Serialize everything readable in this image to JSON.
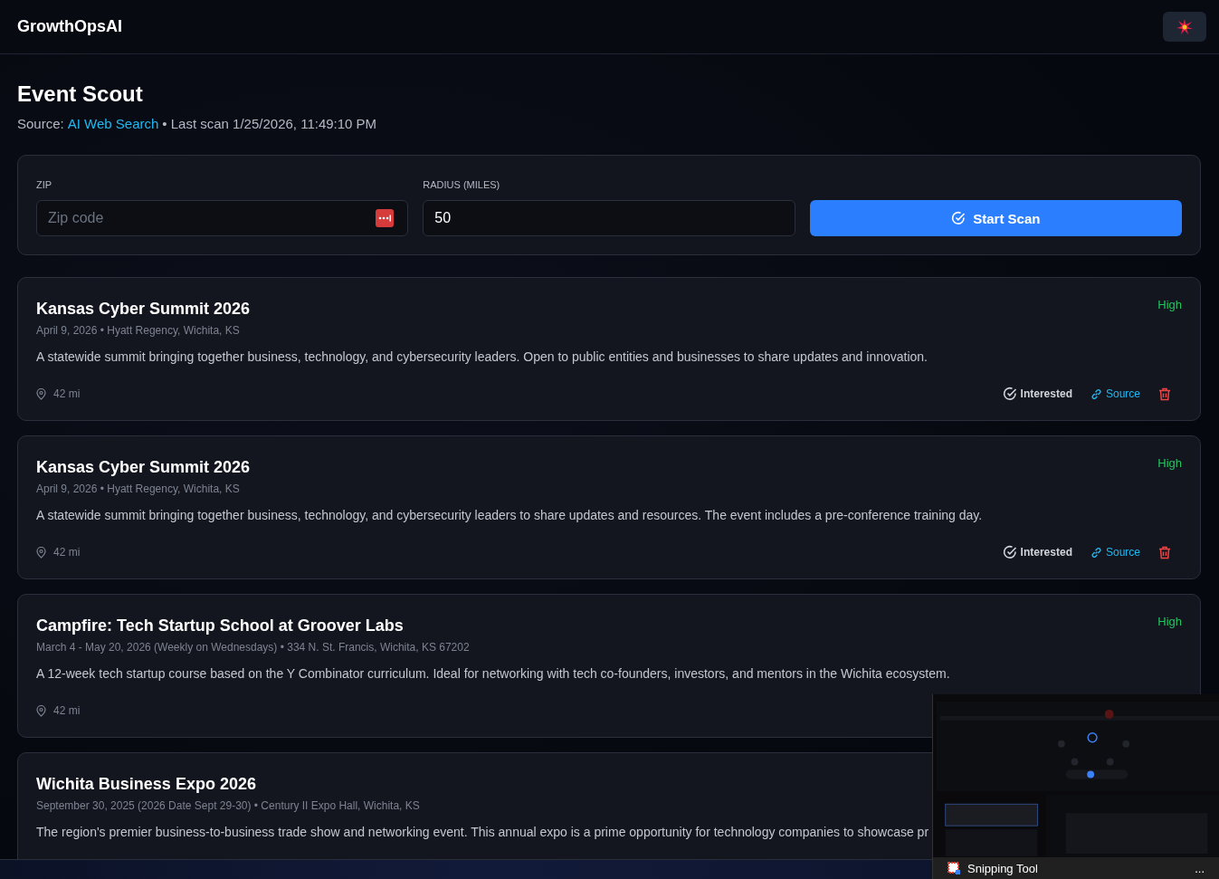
{
  "app": {
    "brand": "GrowthOpsAI"
  },
  "page": {
    "title": "Event Scout",
    "source_label": "Source:",
    "source_link": "AI Web Search",
    "last_scan": "• Last scan 1/25/2026, 11:49:10 PM"
  },
  "scan_form": {
    "zip_label": "ZIP",
    "zip_placeholder": "Zip code",
    "radius_label": "RADIUS (MILES)",
    "radius_value": "50",
    "button": "Start Scan"
  },
  "events": [
    {
      "title": "Kansas Cyber Summit 2026",
      "meta": "April 9, 2026 • Hyatt Regency, Wichita, KS",
      "description": "A statewide summit bringing together business, technology, and cybersecurity leaders. Open to public entities and businesses to share updates and innovation.",
      "priority": "High",
      "distance": "42 mi",
      "actions": [
        {
          "kind": "interested",
          "label": "Interested"
        },
        {
          "kind": "source",
          "label": "Source"
        },
        {
          "kind": "delete"
        }
      ]
    },
    {
      "title": "Kansas Cyber Summit 2026",
      "meta": "April 9, 2026 • Hyatt Regency, Wichita, KS",
      "description": "A statewide summit bringing together business, technology, and cybersecurity leaders to share updates and resources. The event includes a pre-conference training day.",
      "priority": "High",
      "distance": "42 mi",
      "actions": [
        {
          "kind": "interested",
          "label": "Interested"
        },
        {
          "kind": "source",
          "label": "Source"
        },
        {
          "kind": "delete"
        }
      ]
    },
    {
      "title": "Campfire: Tech Startup School at Groover Labs",
      "meta": "March 4 - May 20, 2026 (Weekly on Wednesdays) • 334 N. St. Francis, Wichita, KS 67202",
      "description": "A 12-week tech startup course based on the Y Combinator curriculum. Ideal for networking with tech co-founders, investors, and mentors in the Wichita ecosystem.",
      "priority": "High",
      "distance": "42 mi"
    },
    {
      "title": "Wichita Business Expo 2026",
      "meta": "September 30, 2025 (2026 Date Sept 29-30) • Century II Expo Hall, Wichita, KS",
      "description": "The region's premier business-to-business trade show and networking event. This annual expo is a prime opportunity for technology companies to showcase pr"
    }
  ],
  "snip_toast": {
    "title": "Snipping Tool",
    "menu": "..."
  }
}
